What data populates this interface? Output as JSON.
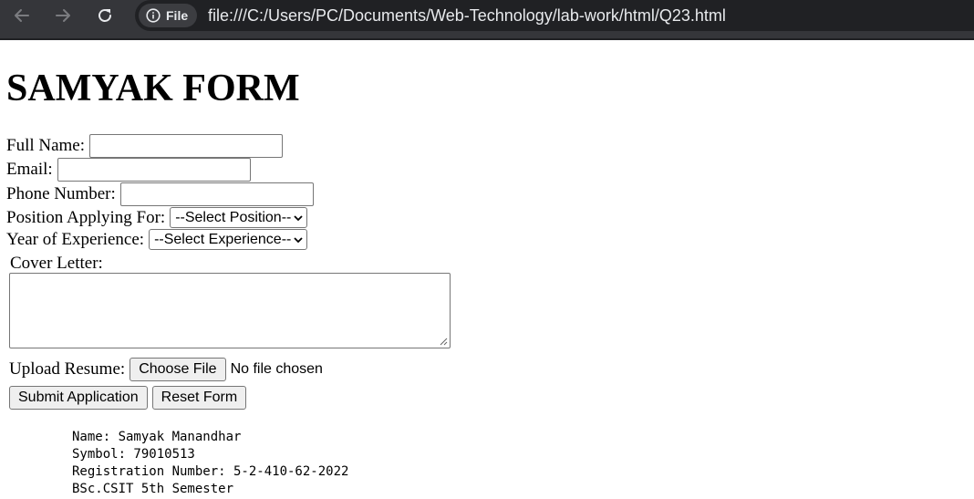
{
  "browser": {
    "back_icon": "arrow-left-icon",
    "forward_icon": "arrow-right-icon",
    "reload_icon": "reload-icon",
    "info_icon": "info-icon",
    "file_chip_label": "File",
    "url": "file:///C:/Users/PC/Documents/Web-Technology/lab-work/html/Q23.html"
  },
  "page": {
    "title": "SAMYAK FORM"
  },
  "form": {
    "full_name": {
      "label": "Full Name:",
      "value": ""
    },
    "email": {
      "label": "Email:",
      "value": ""
    },
    "phone": {
      "label": "Phone Number:",
      "value": ""
    },
    "position": {
      "label": "Position Applying For:",
      "selected": "--Select Position--"
    },
    "experience": {
      "label": "Year of Experience:",
      "selected": "--Select Experience--"
    },
    "cover_letter": {
      "label": "Cover Letter:",
      "value": ""
    },
    "resume": {
      "label": "Upload Resume:",
      "button_label": "Choose File",
      "status": "No file chosen"
    },
    "submit_label": "Submit Application",
    "reset_label": "Reset Form"
  },
  "info": {
    "lines": [
      "Name: Samyak Manandhar",
      "Symbol: 79010513",
      "Registration Number: 5-2-410-62-2022",
      "BSc.CSIT 5th Semester"
    ]
  }
}
